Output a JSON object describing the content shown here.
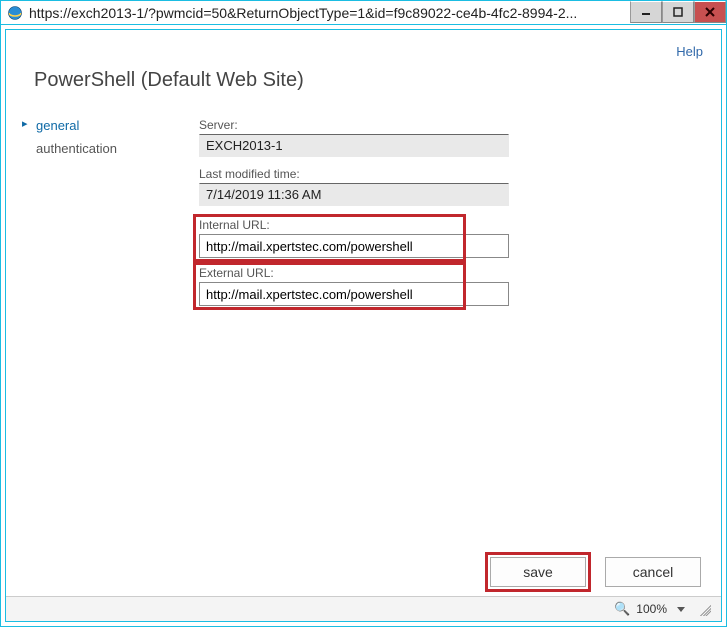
{
  "window": {
    "url": "https://exch2013-1/?pwmcid=50&ReturnObjectType=1&id=f9c89022-ce4b-4fc2-8994-2..."
  },
  "help_label": "Help",
  "page_title": "PowerShell (Default Web Site)",
  "sidebar": {
    "items": [
      {
        "label": "general",
        "active": true
      },
      {
        "label": "authentication",
        "active": false
      }
    ]
  },
  "form": {
    "server_label": "Server:",
    "server_value": "EXCH2013-1",
    "modified_label": "Last modified time:",
    "modified_value": "7/14/2019 11:36 AM",
    "internal_url_label": "Internal URL:",
    "internal_url_value": "http://mail.xpertstec.com/powershell",
    "external_url_label": "External URL:",
    "external_url_value": "http://mail.xpertstec.com/powershell"
  },
  "buttons": {
    "save": "save",
    "cancel": "cancel"
  },
  "status": {
    "zoom": "100%"
  }
}
